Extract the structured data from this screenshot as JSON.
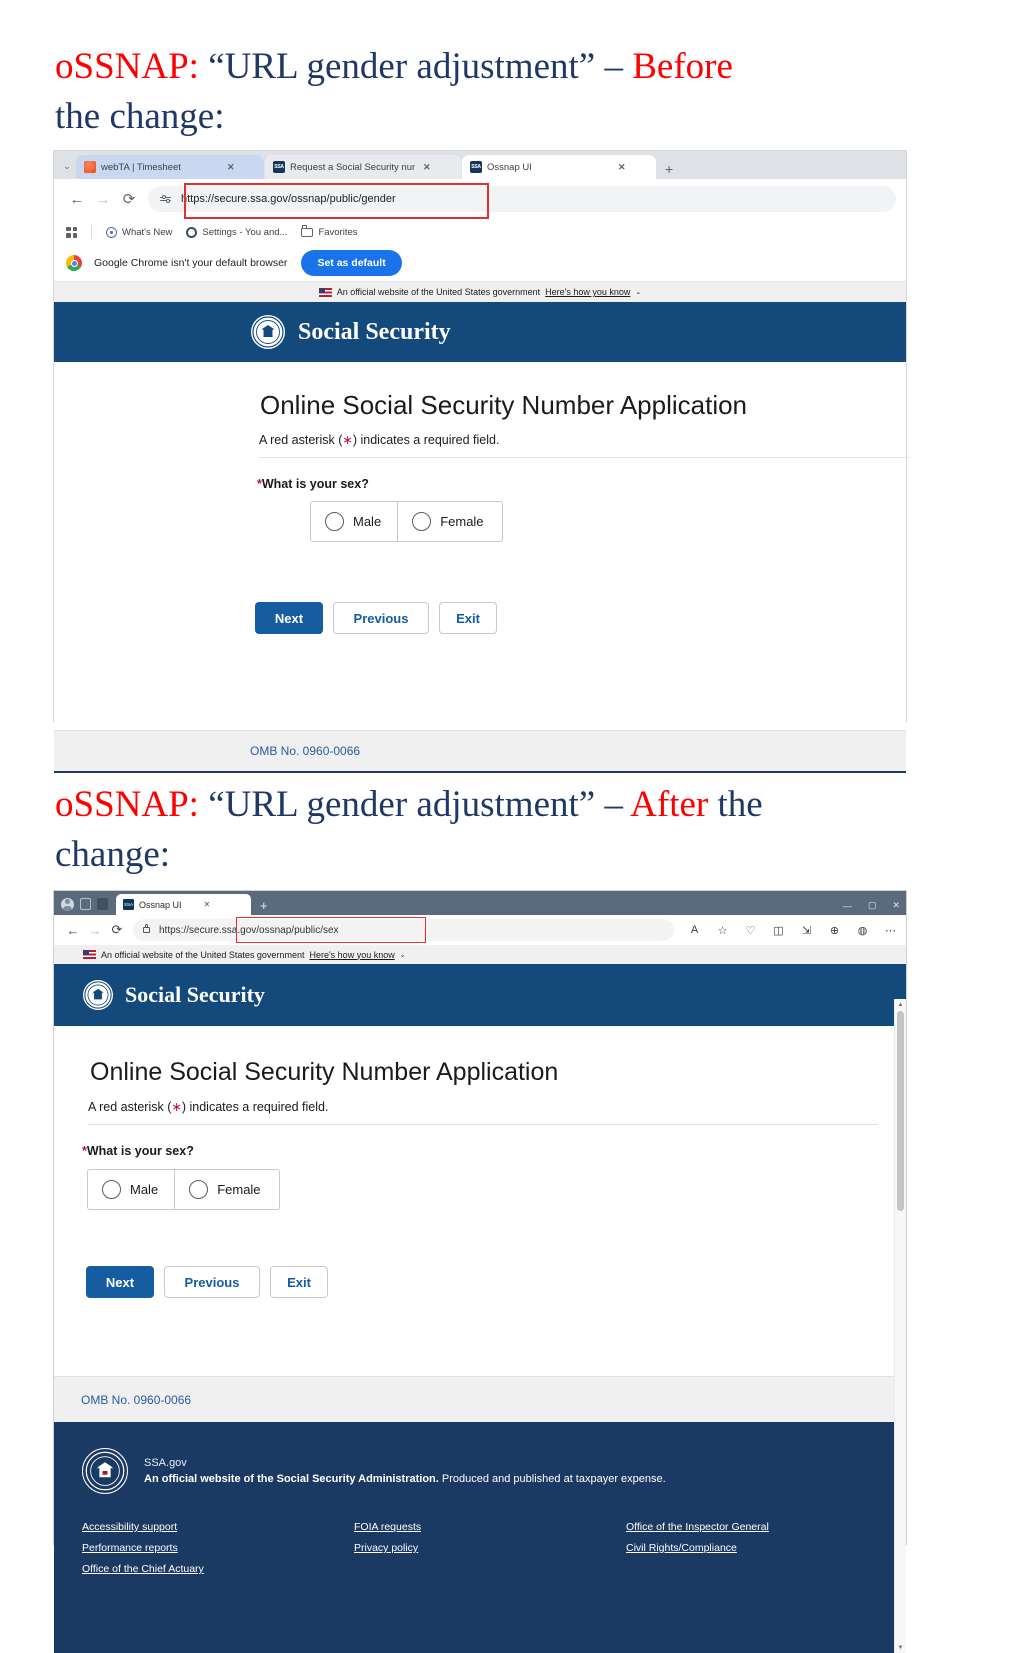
{
  "slides": {
    "before": {
      "part1": "oSSNAP: ",
      "part2": "“URL gender adjustment” – ",
      "part3": "Before",
      "part4": "the change:"
    },
    "after": {
      "part1": "oSSNAP: ",
      "part2": "“URL gender adjustment” – ",
      "part3": "After",
      "part4": "the",
      "part5": "change:"
    }
  },
  "colors": {
    "heading_red": "#FF0000",
    "heading_navy": "#1F3864",
    "ssa_blue": "#14497b",
    "primary_button": "#155ca0",
    "highlight_red": "#e03030",
    "footer_navy": "#1b3a63"
  },
  "chrome": {
    "tabs": [
      {
        "title": "webTA | Timesheet",
        "favicon": "webta-icon",
        "close": "✕",
        "state": "inactive"
      },
      {
        "title": "Request a Social Security numb",
        "favicon": "ssa-icon",
        "close": "✕",
        "state": "inactive"
      },
      {
        "title": "Ossnap UI",
        "favicon": "ssa-icon",
        "close": "✕",
        "state": "active"
      }
    ],
    "new_tab": "+",
    "tab_list_caret": "⌄",
    "nav": {
      "back": "←",
      "forward": "→",
      "reload": "⟳"
    },
    "omnibox": {
      "url": "https://secure.ssa.gov/ossnap/public/gender",
      "icon": "site-settings-icon"
    },
    "bookmarks": [
      {
        "label": "What's New",
        "icon": "compass-icon"
      },
      {
        "label": "Settings - You and...",
        "icon": "gear-icon"
      },
      {
        "label": "Favorites",
        "icon": "folder-icon"
      }
    ],
    "infobar": {
      "message": "Google Chrome isn't your default browser",
      "button": "Set as default"
    }
  },
  "edge": {
    "tab": {
      "title": "Ossnap UI",
      "favicon": "ssa-icon",
      "close": "✕"
    },
    "new_tab": "+",
    "window_controls": {
      "minimize": "—",
      "maximize": "▢",
      "close": "✕"
    },
    "nav": {
      "back": "←",
      "forward": "→",
      "reload": "⟳"
    },
    "omnibox": {
      "url": "https://secure.ssa.gov/ossnap/public/sex",
      "icon": "lock-icon"
    },
    "tools": [
      {
        "icon": "read-aloud-icon",
        "glyph": "A"
      },
      {
        "icon": "favorite-star-icon",
        "glyph": "☆"
      },
      {
        "icon": "browser-essentials-icon",
        "glyph": "♡"
      },
      {
        "icon": "split-screen-icon",
        "glyph": "◫"
      },
      {
        "icon": "collections-icon",
        "glyph": "⇲"
      },
      {
        "icon": "extensions-icon",
        "glyph": "⊕"
      },
      {
        "icon": "copilot-icon",
        "glyph": "◍"
      },
      {
        "icon": "settings-more-icon",
        "glyph": "⋯"
      }
    ]
  },
  "usa_banner": {
    "text": "An official website of the United States government",
    "link": "Here's how you know",
    "caret": "⌄"
  },
  "masthead": {
    "wordmark": "Social Security",
    "seal": "ssa-seal-icon"
  },
  "form": {
    "title": "Online Social Security Number Application",
    "required_note_prefix": "A red asterisk (",
    "required_note_star": "∗",
    "required_note_suffix": ") indicates a required field.",
    "question_star": "*",
    "question": "What is your sex?",
    "options": [
      {
        "label": "Male",
        "value": "male",
        "selected": false
      },
      {
        "label": "Female",
        "value": "female",
        "selected": false
      }
    ],
    "buttons": [
      {
        "label": "Next",
        "style": "primary"
      },
      {
        "label": "Previous",
        "style": "outline"
      },
      {
        "label": "Exit",
        "style": "outline"
      }
    ],
    "omb": "OMB No. 0960-0066"
  },
  "site_footer": {
    "seal": "ssa-seal-icon",
    "ssa_gov": "SSA.gov",
    "tagline_bold": "An official website of the Social Security Administration.",
    "tagline_rest": " Produced and published at taxpayer expense.",
    "columns": [
      [
        {
          "label": "Accessibility support"
        },
        {
          "label": "Performance reports"
        },
        {
          "label": "Office of the Chief Actuary"
        }
      ],
      [
        {
          "label": "FOIA requests"
        },
        {
          "label": "Privacy policy"
        }
      ],
      [
        {
          "label": "Office of the Inspector General"
        },
        {
          "label": "Civil Rights/Compliance"
        }
      ]
    ]
  }
}
